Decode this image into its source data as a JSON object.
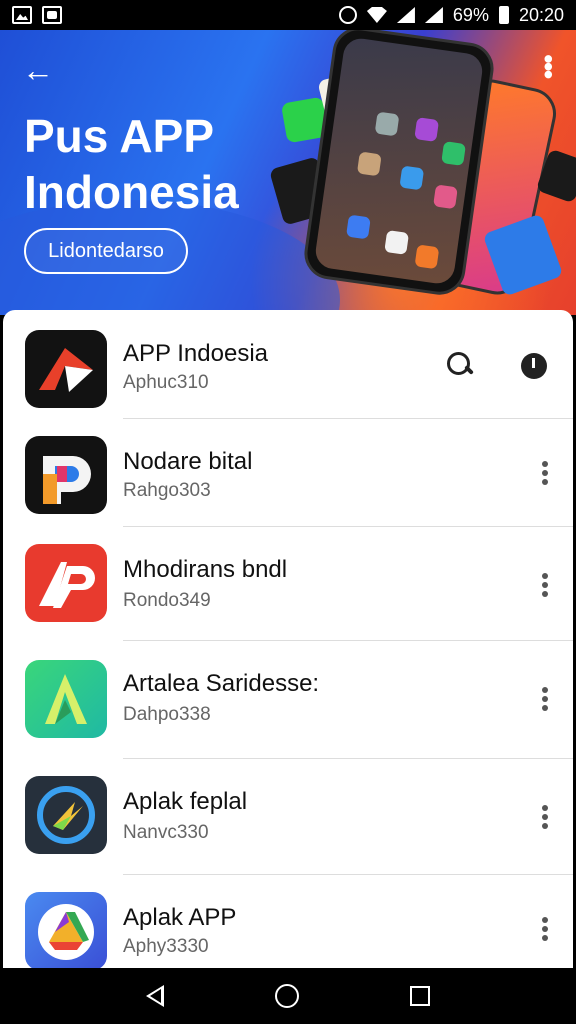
{
  "status_bar": {
    "battery": "69%",
    "time": "20:20"
  },
  "hero": {
    "title": "Pus APP Indonesia",
    "button_label": "Lidontedarso",
    "colors": {
      "primary": "#2a73f0",
      "accent": "#f0542a"
    }
  },
  "apps": [
    {
      "name": "APP Indoesia",
      "subtitle": "Aphuc310",
      "icon": "red-arrow-app-icon",
      "color": "#1a1a1a"
    },
    {
      "name": "Nodare bital",
      "subtitle": "Rahgo303",
      "icon": "p-logo-app-icon",
      "color": "#141414"
    },
    {
      "name": "Mhodirans bndl",
      "subtitle": "Rondo349",
      "icon": "ap-red-app-icon",
      "color": "#e83a2e"
    },
    {
      "name": "Artalea Saridesse:",
      "subtitle": "Dahpo338",
      "icon": "a-green-app-icon",
      "color": "#2cc58a"
    },
    {
      "name": "Aplak feplal",
      "subtitle": "Nanvc330",
      "icon": "compass-app-icon",
      "color": "#2a3440"
    },
    {
      "name": "Aplak APP",
      "subtitle": "Aphy3330",
      "icon": "drive-app-icon",
      "color": "#3d63e0"
    }
  ]
}
